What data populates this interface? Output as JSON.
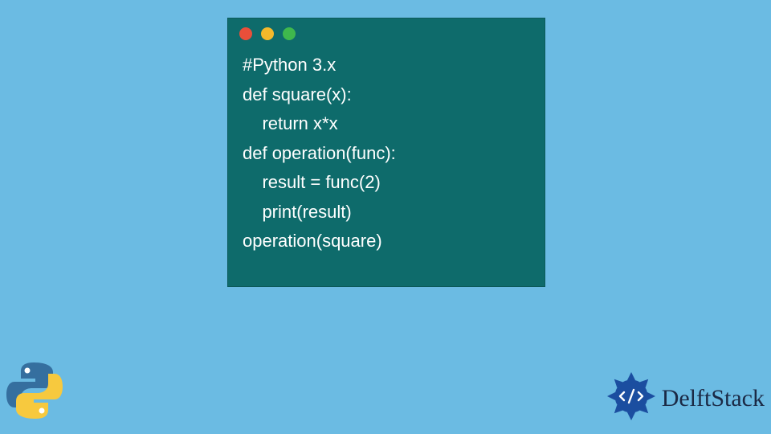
{
  "window": {
    "dots": {
      "red": "#e94f3a",
      "yellow": "#f4b92b",
      "green": "#3fb84d"
    }
  },
  "code": {
    "line1": "#Python 3.x",
    "line2": "def square(x):",
    "line3": "    return x*x",
    "line4": "def operation(func):",
    "line5": "    result = func(2)",
    "line6": "    print(result)",
    "line7": "operation(square)"
  },
  "branding": {
    "site_name": "DelftStack"
  },
  "colors": {
    "page_bg": "#6bbbe3",
    "window_bg": "#0e6b6b",
    "code_text": "#ffffff",
    "brand_text": "#1b2945",
    "brand_emblem": "#1b4ea0",
    "python_blue": "#356f9f",
    "python_yellow": "#f7c93e"
  }
}
